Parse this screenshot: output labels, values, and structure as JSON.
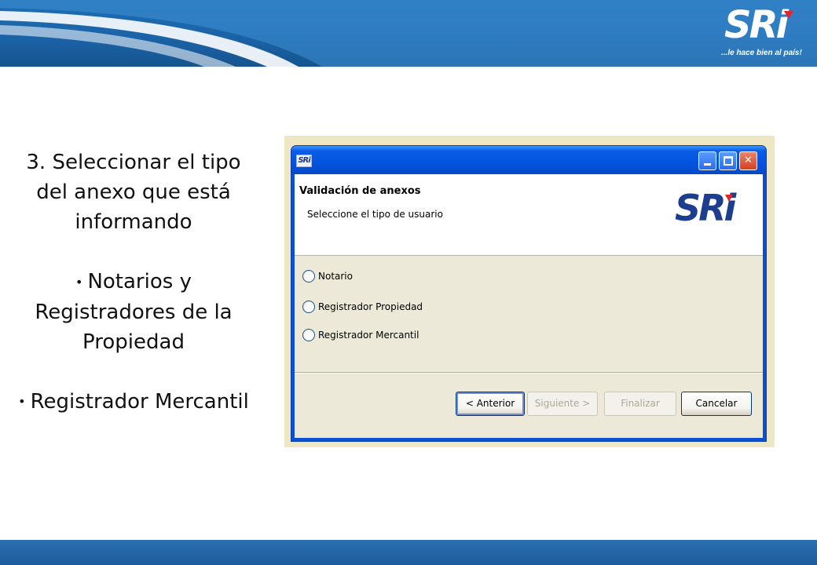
{
  "slide": {
    "logo_text": "SRi",
    "slogan": "...le hace bien al país!",
    "instructions": {
      "line1": "3. Seleccionar el tipo",
      "line2": "del anexo que está",
      "line3": "informando",
      "bullet1_line1": "Notarios y",
      "bullet1_line2": "Registradores de la",
      "bullet1_line3": "Propiedad",
      "bullet2": "Registrador Mercantil"
    }
  },
  "window": {
    "icon_text": "SRi",
    "title": ""
  },
  "wizard": {
    "title": "Validación de anexos",
    "subtitle": "Seleccione el tipo de usuario",
    "logo_text": "SRi",
    "options": [
      {
        "label": "Notario",
        "selected": false
      },
      {
        "label": "Registrador Propiedad",
        "selected": false
      },
      {
        "label": "Registrador Mercantil",
        "selected": false
      }
    ],
    "buttons": {
      "prev": "< Anterior",
      "next": "Siguiente >",
      "finish": "Finalizar",
      "cancel": "Cancelar"
    }
  },
  "colors": {
    "banner_blue": "#1b63a8",
    "titlebar_blue": "#0553e0",
    "logo_navy": "#1d3e8f",
    "logo_red": "#e2262f",
    "dialog_face": "#ece9d8"
  }
}
